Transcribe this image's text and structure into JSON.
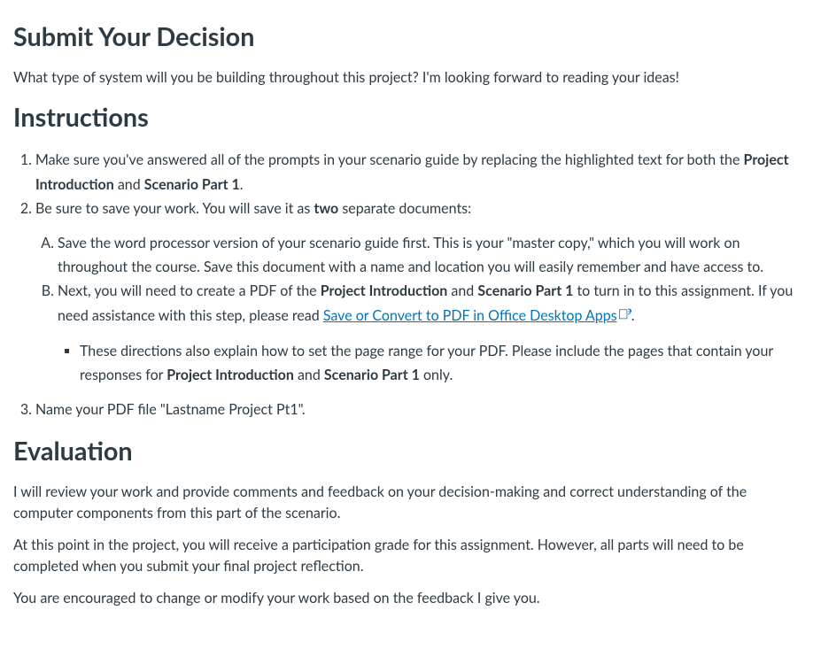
{
  "heading1": "Submit Your Decision",
  "intro_p": "What type of system will you be building throughout this project? I'm looking forward to reading your ideas!",
  "heading2": "Instructions",
  "instr": {
    "li1_a": "Make sure you've answered all of the prompts in your scenario guide by replacing the highlighted text for both the ",
    "li1_b1": "Project Introduction",
    "li1_c": " and ",
    "li1_b2": "Scenario Part 1",
    "li1_d": ".",
    "li2_a": "Be sure to save your work. You will save it as ",
    "li2_b": "two",
    "li2_c": " separate documents:",
    "subA": "Save the word processor version of your scenario guide first. This is your \"master copy,\" which you will work on throughout the course. Save this document with a name and location you will easily remember and have access to.",
    "subB_a": "Next, you will need to create a PDF of the ",
    "subB_b1": "Project Introduction",
    "subB_b": " and ",
    "subB_b2": "Scenario Part 1",
    "subB_c": " to turn in to this assignment. If you need assistance with this step, please read ",
    "subB_link": "Save or Convert to PDF in Office Desktop Apps",
    "subB_d": ".",
    "bullet_a": "These directions also explain how to set the page range for your PDF. Please include the pages that contain your responses for ",
    "bullet_b1": "Project Introduction",
    "bullet_b": " and ",
    "bullet_b2": "Scenario Part 1",
    "bullet_c": " only.",
    "li3": "Name your PDF file \"Lastname Project Pt1\"."
  },
  "heading3": "Evaluation",
  "eval_p1": "I will review your work and provide comments and feedback on your decision-making and correct understanding of the computer components from this part of the scenario.",
  "eval_p2": "At this point in the project, you will receive a participation grade for this assignment. However, all parts will need to be completed when you submit your final project reflection.",
  "eval_p3": "You are encouraged to change or modify your work based on the feedback I give you."
}
